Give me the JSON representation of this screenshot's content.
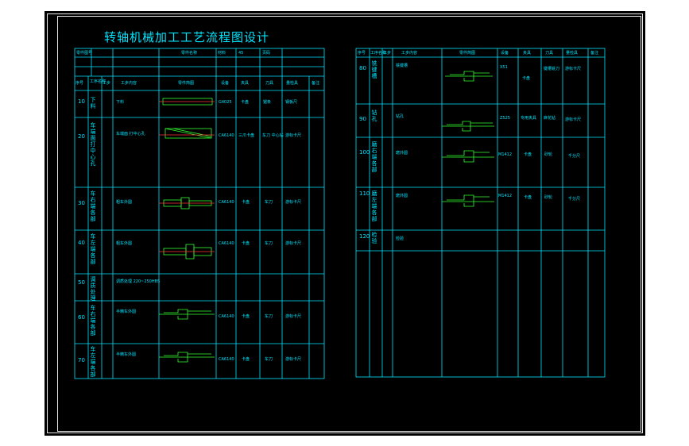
{
  "title": "转轴机械加工工艺流程图设计",
  "left_table": {
    "info_row1": [
      "零件图号",
      "零件名称",
      "材料",
      "45",
      "页码"
    ],
    "headers": [
      "序号",
      "工序名称",
      "工步",
      "工步内容",
      "零件简图",
      "设备",
      "夹具",
      "刀具",
      "量检具",
      "备注"
    ],
    "steps": [
      {
        "no": "10",
        "name": "下料",
        "content": "下料",
        "equip": "G4025",
        "fixture": "卡盘",
        "tool": "锯条",
        "gauge": "钢板尺"
      },
      {
        "no": "20",
        "name": "车端面打中心孔",
        "content": "车端面  打中心孔",
        "equip": "CA6140",
        "fixture": "三爪卡盘",
        "tool": "车刀 中心钻",
        "gauge": "游标卡尺"
      },
      {
        "no": "30",
        "name": "车右端各部",
        "content": "粗车外圆",
        "equip": "CA6140",
        "fixture": "卡盘",
        "tool": "车刀",
        "gauge": "游标卡尺"
      },
      {
        "no": "40",
        "name": "车左端各部",
        "content": "粗车外圆",
        "equip": "CA6140",
        "fixture": "卡盘",
        "tool": "车刀",
        "gauge": "游标卡尺"
      },
      {
        "no": "50",
        "name": "调质处理",
        "content": "调质处理 220~250HBS",
        "equip": "",
        "fixture": "",
        "tool": "",
        "gauge": ""
      },
      {
        "no": "60",
        "name": "车右端各部",
        "content": "半精车外圆",
        "equip": "CA6140",
        "fixture": "卡盘",
        "tool": "车刀",
        "gauge": "游标卡尺"
      },
      {
        "no": "70",
        "name": "车左端各部",
        "content": "半精车外圆",
        "equip": "CA6140",
        "fixture": "卡盘",
        "tool": "车刀",
        "gauge": "游标卡尺"
      }
    ]
  },
  "right_table": {
    "headers": [
      "序号",
      "工序名称",
      "工步",
      "工步内容",
      "零件简图",
      "设备",
      "夹具",
      "刀具",
      "量检具",
      "备注"
    ],
    "steps": [
      {
        "no": "80",
        "name": "铣键槽",
        "content": "铣键槽",
        "equip": "X51",
        "fixture": "卡盘",
        "tool": "键槽铣刀",
        "gauge": "游标卡尺"
      },
      {
        "no": "90",
        "name": "钻孔",
        "content": "钻孔",
        "equip": "Z525",
        "fixture": "专用夹具",
        "tool": "麻花钻",
        "gauge": "游标卡尺"
      },
      {
        "no": "100",
        "name": "磨右端各部",
        "content": "磨外圆",
        "equip": "M1412",
        "fixture": "卡盘",
        "tool": "砂轮",
        "gauge": "千分尺"
      },
      {
        "no": "110",
        "name": "磨左端各部",
        "content": "磨外圆",
        "equip": "M1412",
        "fixture": "卡盘",
        "tool": "砂轮",
        "gauge": "千分尺"
      },
      {
        "no": "120",
        "name": "检验",
        "content": "检验",
        "equip": "",
        "fixture": "",
        "tool": "",
        "gauge": ""
      }
    ]
  }
}
